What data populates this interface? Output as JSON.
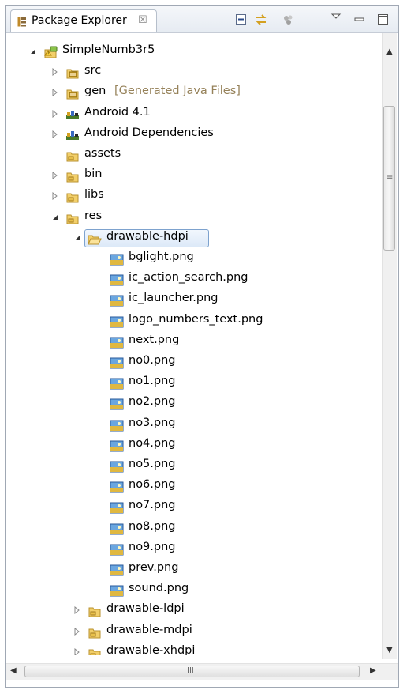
{
  "view": {
    "tab_label": "Package Explorer",
    "tab_close": "☒",
    "toolbar": [
      "collapse-all-icon",
      "link-with-editor-icon",
      "filter-icon",
      "view-menu-icon",
      "minimize-icon",
      "maximize-icon"
    ]
  },
  "tree": [
    {
      "label": "SimpleNumb3r5",
      "expanded": true,
      "icon": "android-project-icon"
    },
    {
      "label": "src",
      "expanded": false,
      "icon": "source-folder-icon"
    },
    {
      "label": "gen",
      "decoration": "[Generated Java Files]",
      "expanded": false,
      "icon": "source-folder-icon"
    },
    {
      "label": "Android 4.1",
      "expanded": false,
      "icon": "library-icon"
    },
    {
      "label": "Android Dependencies",
      "expanded": false,
      "icon": "library-icon"
    },
    {
      "label": "assets",
      "icon": "folder-icon"
    },
    {
      "label": "bin",
      "expanded": false,
      "icon": "folder-icon"
    },
    {
      "label": "libs",
      "expanded": false,
      "icon": "folder-icon"
    },
    {
      "label": "res",
      "expanded": true,
      "icon": "folder-icon"
    },
    {
      "label": "drawable-hdpi",
      "expanded": true,
      "selected": true,
      "icon": "open-folder-icon"
    },
    {
      "label": "bglight.png",
      "icon": "image-file-icon"
    },
    {
      "label": "ic_action_search.png",
      "icon": "image-file-icon"
    },
    {
      "label": "ic_launcher.png",
      "icon": "image-file-icon"
    },
    {
      "label": "logo_numbers_text.png",
      "icon": "image-file-icon"
    },
    {
      "label": "next.png",
      "icon": "image-file-icon"
    },
    {
      "label": "no0.png",
      "icon": "image-file-icon"
    },
    {
      "label": "no1.png",
      "icon": "image-file-icon"
    },
    {
      "label": "no2.png",
      "icon": "image-file-icon"
    },
    {
      "label": "no3.png",
      "icon": "image-file-icon"
    },
    {
      "label": "no4.png",
      "icon": "image-file-icon"
    },
    {
      "label": "no5.png",
      "icon": "image-file-icon"
    },
    {
      "label": "no6.png",
      "icon": "image-file-icon"
    },
    {
      "label": "no7.png",
      "icon": "image-file-icon"
    },
    {
      "label": "no8.png",
      "icon": "image-file-icon"
    },
    {
      "label": "no9.png",
      "icon": "image-file-icon"
    },
    {
      "label": "prev.png",
      "icon": "image-file-icon"
    },
    {
      "label": "sound.png",
      "icon": "image-file-icon"
    },
    {
      "label": "drawable-ldpi",
      "expanded": false,
      "icon": "folder-icon"
    },
    {
      "label": "drawable-mdpi",
      "expanded": false,
      "icon": "folder-icon"
    },
    {
      "label": "drawable-xhdpi",
      "expanded": false,
      "icon": "folder-icon"
    }
  ],
  "scrollbar": {
    "h_grip": "III"
  },
  "colors": {
    "selection_border": "#7da2ce",
    "decoration_text": "#96825a",
    "frame_border": "#a0a8b4"
  }
}
